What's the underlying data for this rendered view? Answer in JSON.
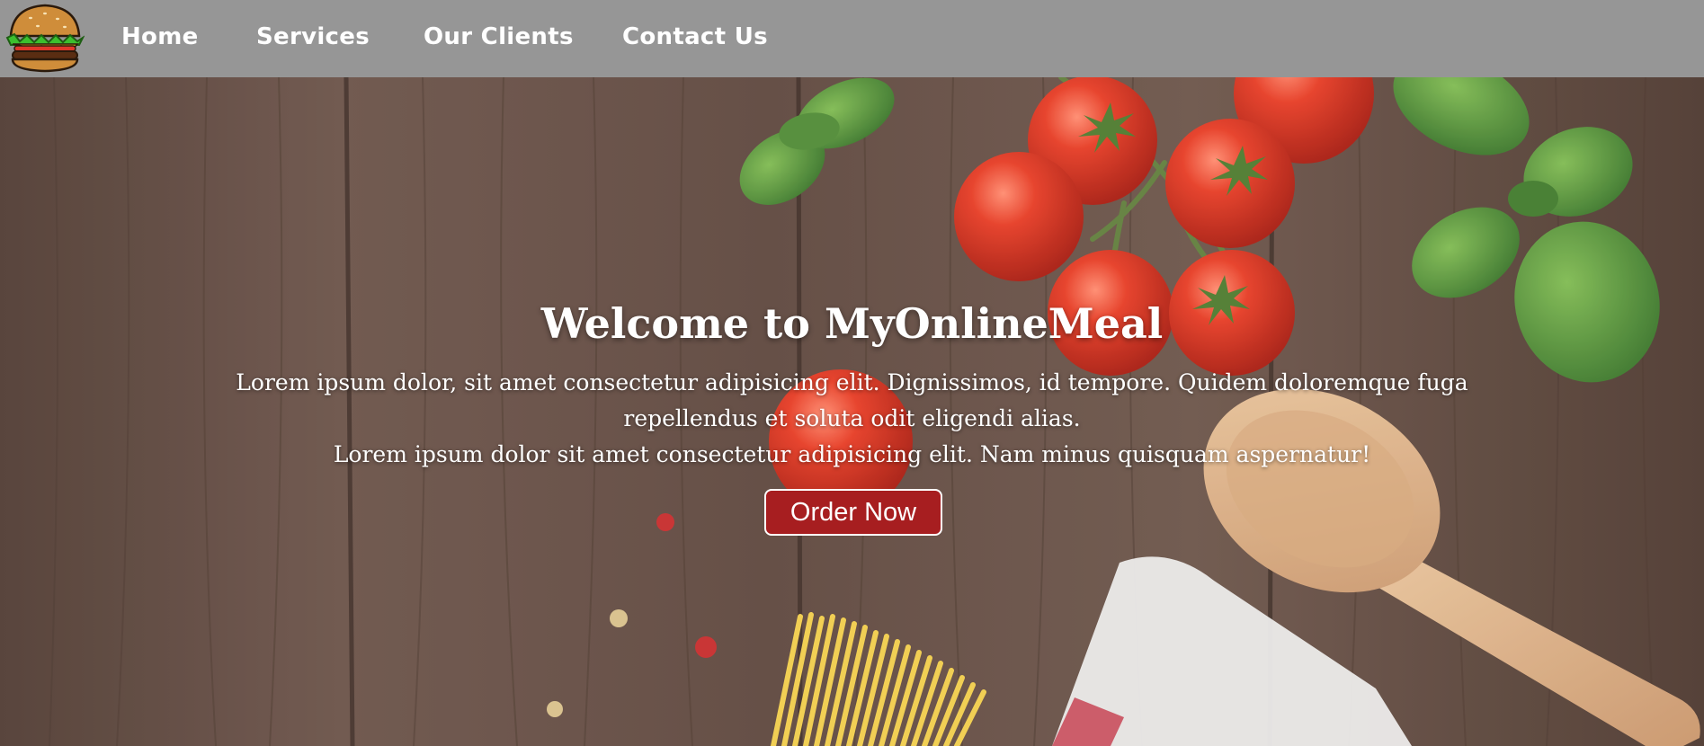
{
  "nav": {
    "logo_icon": "burger-logo-icon",
    "items": [
      {
        "label": "Home"
      },
      {
        "label": "Services"
      },
      {
        "label": "Our Clients"
      },
      {
        "label": "Contact Us"
      }
    ],
    "background_color": "#969696"
  },
  "hero": {
    "title": "Welcome to MyOnlineMeal",
    "text_line_1": "Lorem ipsum dolor, sit amet consectetur adipisicing elit. Dignissimos, id tempore. Quidem doloremque fuga repellendus et soluta odit eligendi alias.",
    "text_line_2": "Lorem ipsum dolor sit amet consectetur adipisicing elit. Nam minus quisquam aspernatur!",
    "button_label": "Order Now",
    "button_color": "#a71e20"
  }
}
